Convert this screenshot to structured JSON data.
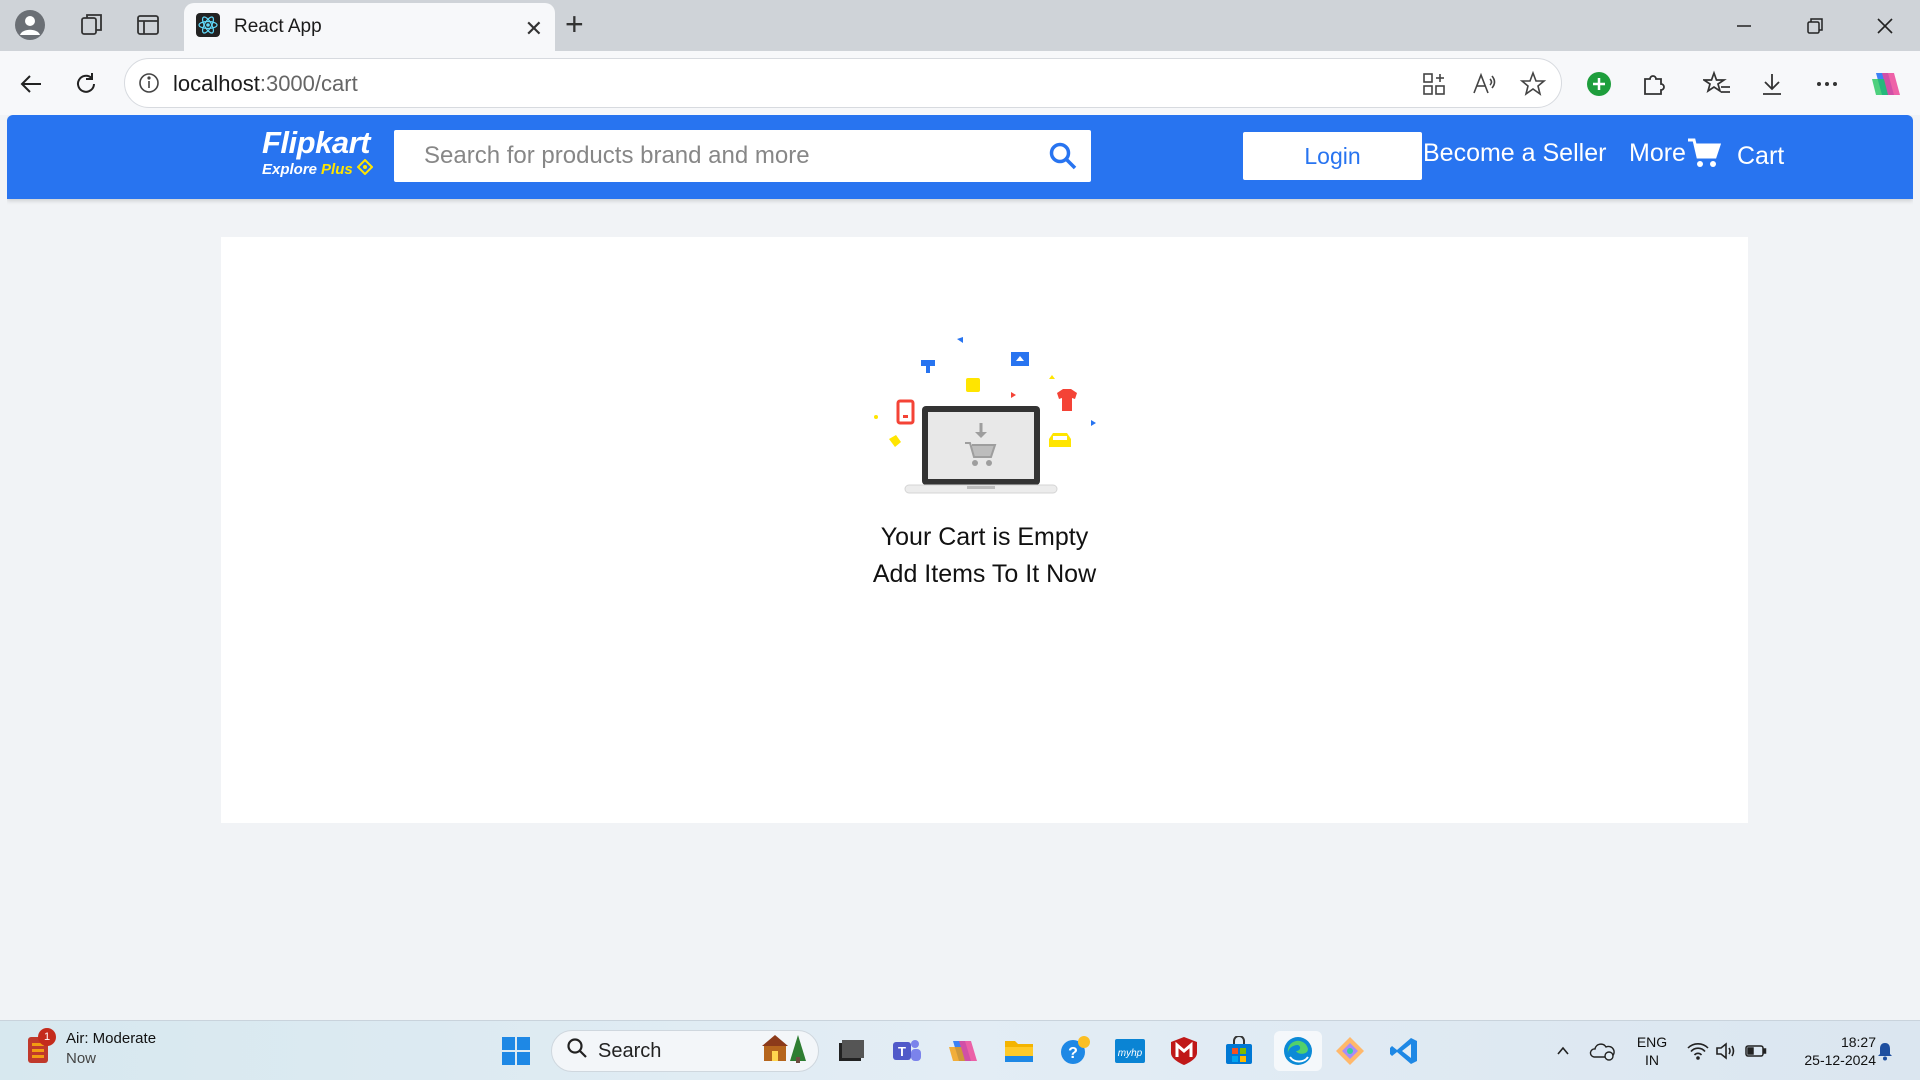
{
  "browser": {
    "tab_title": "React App",
    "tab_close": "✕",
    "new_tab": "+",
    "url_host": "localhost",
    "url_path": ":3000/cart"
  },
  "header": {
    "logo": "Flipkart",
    "logo_sub": "Explore",
    "logo_plus": "Plus",
    "search_placeholder": "Search for products brand and more",
    "login_label": "Login",
    "seller_label": "Become a Seller",
    "more_label": "More",
    "cart_label": "Cart"
  },
  "cart": {
    "empty_title": "Your Cart is Empty",
    "empty_subtitle": "Add Items To It Now"
  },
  "taskbar": {
    "weather_title": "Air: Moderate",
    "weather_sub": "Now",
    "weather_badge": "1",
    "search_label": "Search",
    "lang_line1": "ENG",
    "lang_line2": "IN",
    "time": "18:27",
    "date": "25-12-2024"
  },
  "colors": {
    "brand_blue": "#2874f0",
    "brand_yellow": "#ffe500",
    "page_bg": "#f1f3f6"
  },
  "icons": [
    "profile-icon",
    "collections-icon",
    "tab-actions-icon",
    "react-icon",
    "back-icon",
    "refresh-icon",
    "info-icon",
    "app-icon",
    "read-aloud-icon",
    "favorite-icon",
    "extension-icon",
    "favorites-icon",
    "download-icon",
    "more-icon",
    "copilot-icon",
    "search-icon",
    "cart-icon",
    "windows-icon"
  ]
}
